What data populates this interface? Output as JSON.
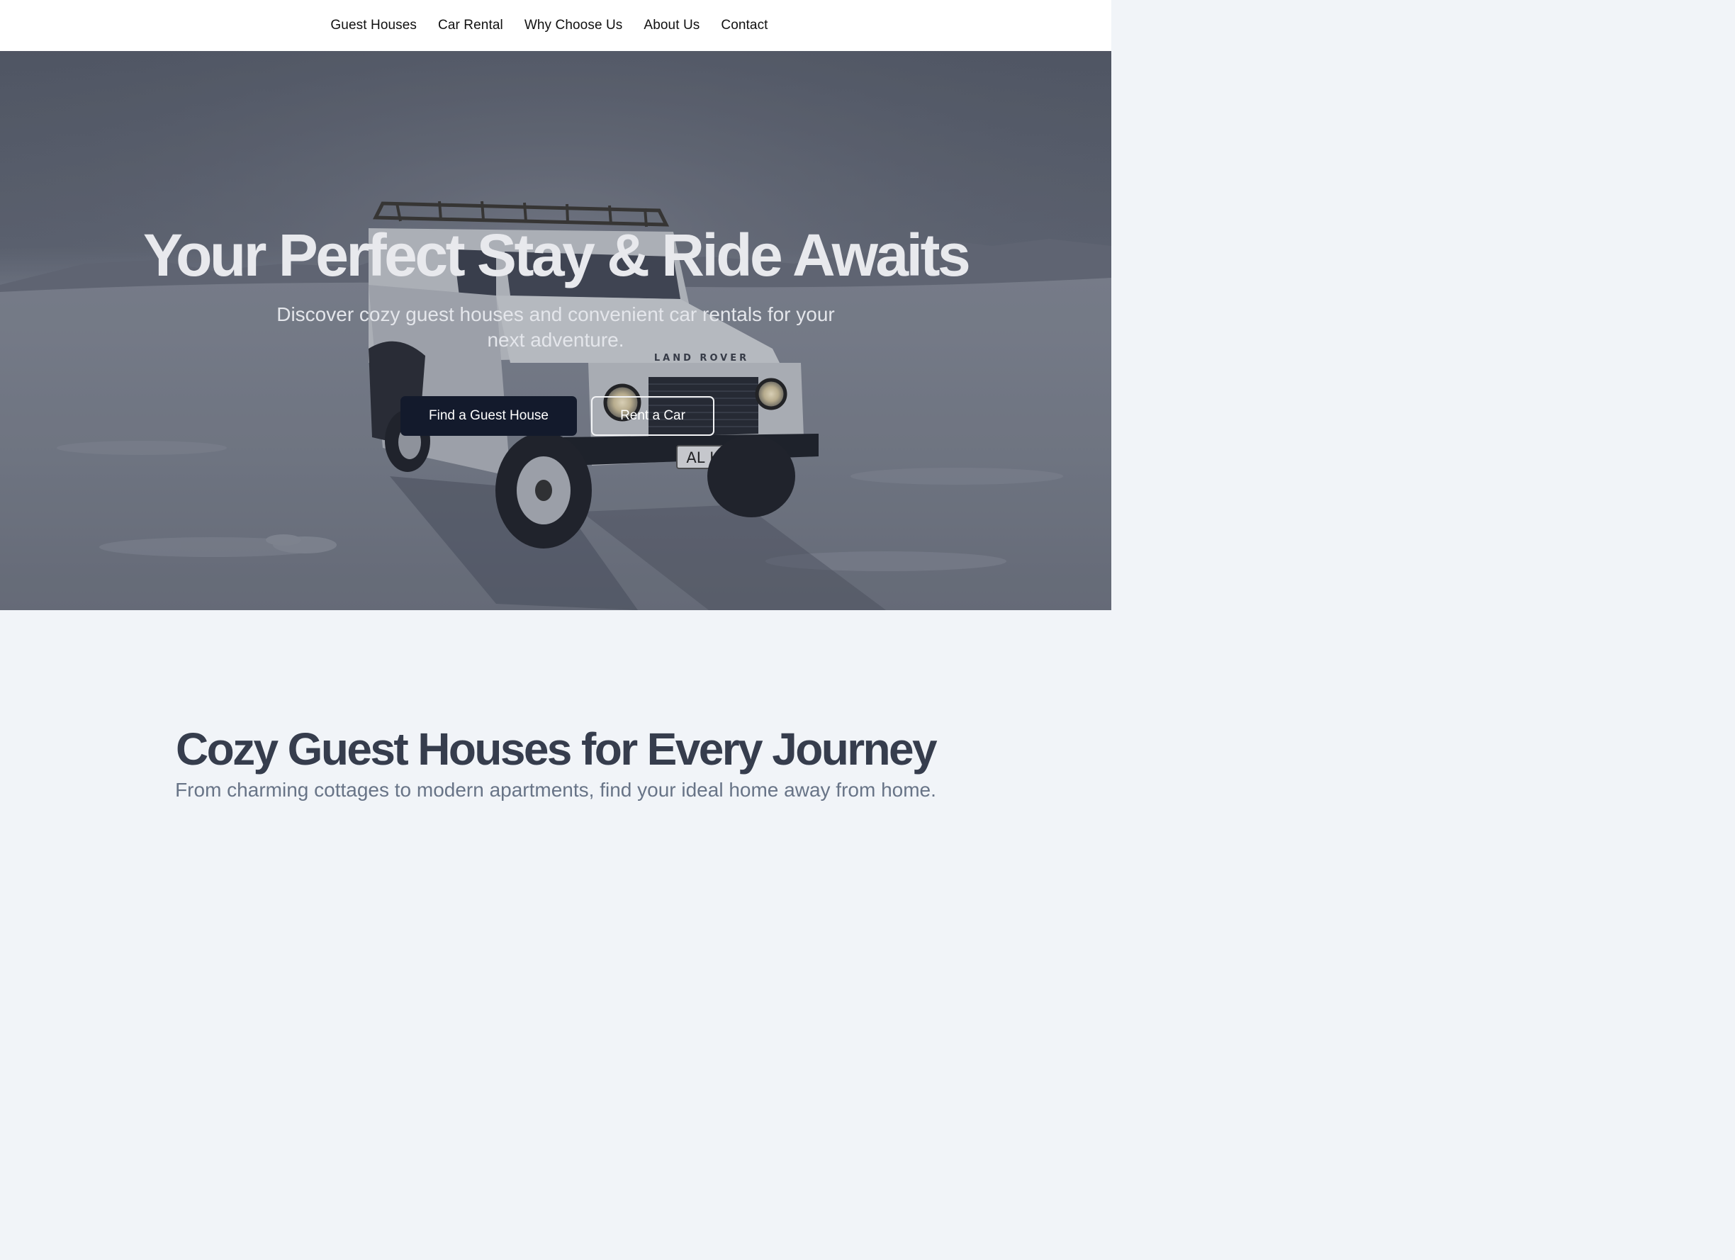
{
  "nav": {
    "links": [
      "Guest Houses",
      "Car Rental",
      "Why Choose Us",
      "About Us",
      "Contact"
    ]
  },
  "hero": {
    "title": "Your Perfect Stay & Ride Awaits",
    "subtitle": "Discover cozy guest houses and convenient car rentals for your next adventure.",
    "primary_button": "Find a Guest House",
    "secondary_button": "Rent a Car",
    "image_plate": "AL H12",
    "image_badge": "LAND ROVER"
  },
  "guest_section": {
    "title": "Cozy Guest Houses for Every Journey",
    "subtitle": "From charming cottages to modern apartments, find your ideal home away from home."
  },
  "colors": {
    "nav_bg": "#ffffff",
    "primary_button": "#131a2c",
    "section_bg": "#f1f4f8",
    "section_title": "#363d4d",
    "section_subtitle": "#687487"
  }
}
